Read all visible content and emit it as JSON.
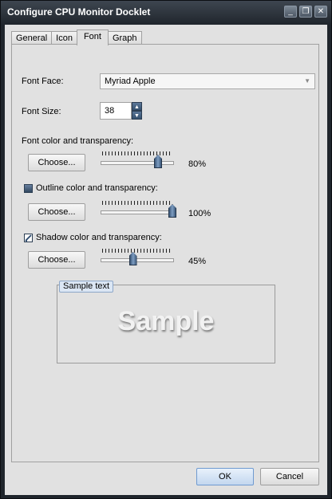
{
  "window": {
    "title": "Configure CPU Monitor Docklet",
    "minimize_icon": "minimize-icon",
    "restore_icon": "restore-icon",
    "close_icon": "close-icon"
  },
  "tabs": [
    {
      "label": "General"
    },
    {
      "label": "Icon"
    },
    {
      "label": "Font",
      "active": true
    },
    {
      "label": "Graph"
    }
  ],
  "font": {
    "face_label": "Font Face:",
    "face_value": "Myriad Apple",
    "size_label": "Font Size:",
    "size_value": "38"
  },
  "font_color": {
    "label": "Font color and transparency:",
    "button": "Choose...",
    "level": 0.8,
    "value_text": "80%"
  },
  "outline": {
    "label": "Outline color and transparency:",
    "checked": false,
    "button": "Choose...",
    "level": 1.0,
    "value_text": "100%"
  },
  "shadow": {
    "label": "Shadow color and transparency:",
    "checked": true,
    "button": "Choose...",
    "level": 0.45,
    "value_text": "45%"
  },
  "sample": {
    "group_label": "Sample text",
    "text": "Sample"
  },
  "footer": {
    "ok": "OK",
    "cancel": "Cancel"
  }
}
